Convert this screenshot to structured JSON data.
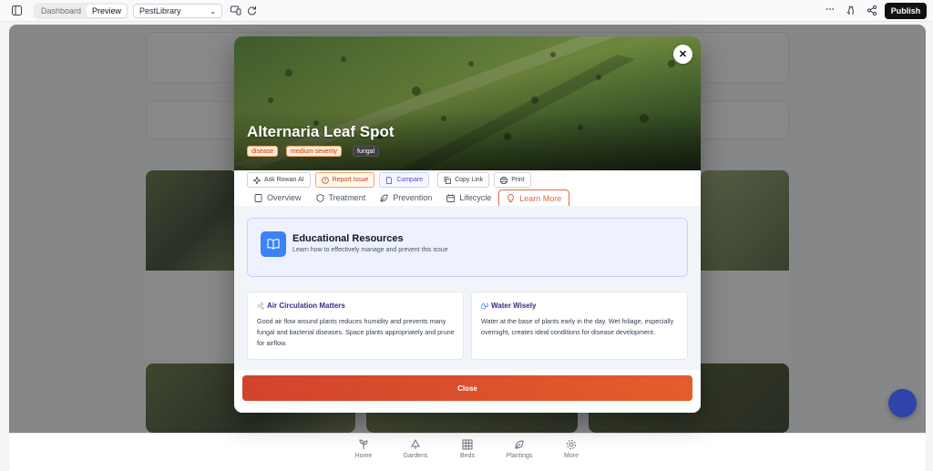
{
  "topbar": {
    "seg_dashboard": "Dashboard",
    "seg_preview": "Preview",
    "project": "PestLibrary",
    "publish": "Publish"
  },
  "modal": {
    "title": "Alternaria Leaf Spot",
    "tags": [
      "disease",
      "medium severity",
      "fungal"
    ],
    "actions": {
      "ask": "Ask Rowan AI",
      "report": "Report Issue",
      "compare": "Compare",
      "copy": "Copy Link",
      "print": "Print"
    },
    "tabs": {
      "overview": "Overview",
      "treatment": "Treatment",
      "prevention": "Prevention",
      "lifecycle": "Lifecycle",
      "learn": "Learn More"
    },
    "education": {
      "title": "Educational Resources",
      "subtitle": "Learn how to effectively manage and prevent this issue"
    },
    "cards": [
      {
        "title": "Air Circulation Matters",
        "body": "Good air flow around plants reduces humidity and prevents many fungal and bacterial diseases. Space plants appropriately and prune for airflow."
      },
      {
        "title": "Water Wisely",
        "body": "Water at the base of plants early in the day. Wet foliage, especially overnight, creates ideal conditions for disease development."
      }
    ],
    "close": "Close"
  },
  "nav": {
    "home": "Home",
    "gardens": "Gardens",
    "beds": "Beds",
    "plantings": "Plantings",
    "more": "More"
  },
  "colors": {
    "accent": "#e0684b",
    "close": "#d2432d",
    "edu": "#3b82f6"
  }
}
